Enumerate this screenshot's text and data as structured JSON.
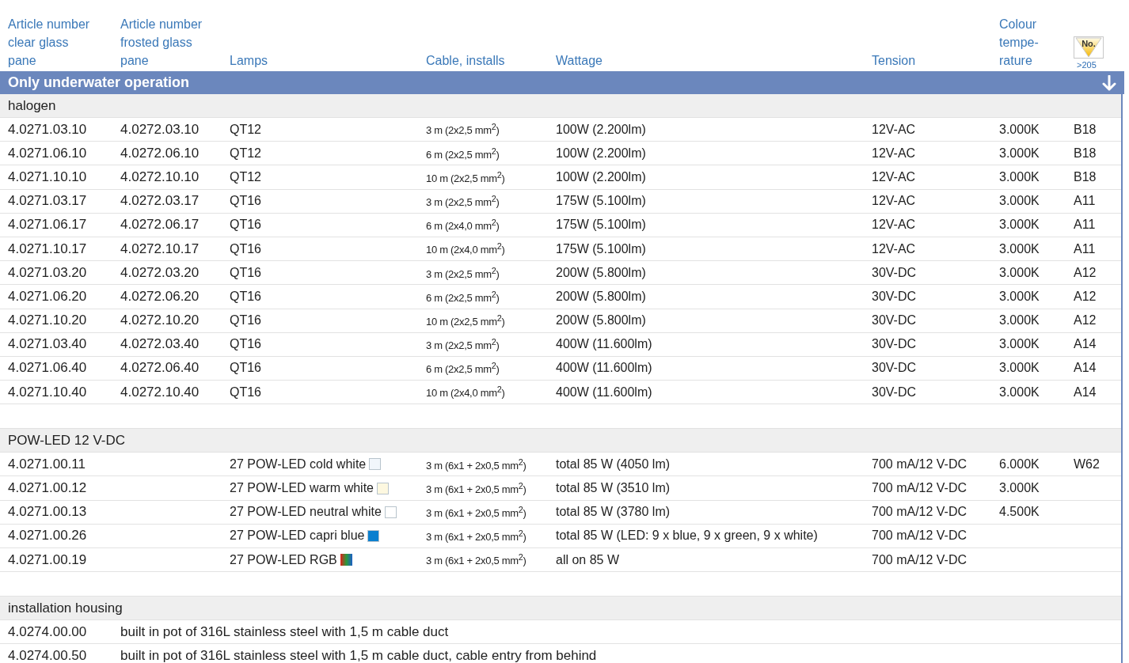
{
  "columns": [
    {
      "lines": [
        "Article number",
        "clear glass",
        "pane"
      ]
    },
    {
      "lines": [
        "Article number",
        "frosted glass",
        "pane"
      ]
    },
    {
      "lines": [
        "Lamps"
      ]
    },
    {
      "lines": [
        "Cable, installs"
      ]
    },
    {
      "lines": [
        "Wattage"
      ]
    },
    {
      "lines": [
        "Tension"
      ]
    },
    {
      "lines": [
        "Colour",
        "tempe-",
        "rature"
      ]
    },
    {
      "kind": "badge",
      "badge_text": "No.",
      "caption": ">205"
    }
  ],
  "banner": {
    "title": "Only underwater operation"
  },
  "sections": [
    {
      "title": "halogen",
      "rows": [
        {
          "kind": "product",
          "clear": "4.0271.03.10",
          "frosted": "4.0272.03.10",
          "lamp": "QT12",
          "cable": "3 m (2x2,5 mm$^{2}$)",
          "wattage": "100W (2.200lm)",
          "tension": "12V-AC",
          "temperature": "3.000K",
          "ref": "B18"
        },
        {
          "kind": "product",
          "clear": "4.0271.06.10",
          "frosted": "4.0272.06.10",
          "lamp": "QT12",
          "cable": "6 m (2x2,5 mm$^{2}$)",
          "wattage": "100W (2.200lm)",
          "tension": "12V-AC",
          "temperature": "3.000K",
          "ref": "B18"
        },
        {
          "kind": "product",
          "clear": "4.0271.10.10",
          "frosted": "4.0272.10.10",
          "lamp": "QT12",
          "cable": "10 m (2x2,5 mm$^{2}$)",
          "wattage": "100W (2.200lm)",
          "tension": "12V-AC",
          "temperature": "3.000K",
          "ref": "B18"
        },
        {
          "kind": "product",
          "clear": "4.0271.03.17",
          "frosted": "4.0272.03.17",
          "lamp": "QT16",
          "cable": "3 m (2x2,5 mm$^{2}$)",
          "wattage": "175W (5.100lm)",
          "tension": "12V-AC",
          "temperature": "3.000K",
          "ref": "A11"
        },
        {
          "kind": "product",
          "clear": "4.0271.06.17",
          "frosted": "4.0272.06.17",
          "lamp": "QT16",
          "cable": "6 m (2x4,0 mm$^{2}$)",
          "wattage": "175W (5.100lm)",
          "tension": "12V-AC",
          "temperature": "3.000K",
          "ref": "A11"
        },
        {
          "kind": "product",
          "clear": "4.0271.10.17",
          "frosted": "4.0272.10.17",
          "lamp": "QT16",
          "cable": "10 m (2x4,0 mm$^{2}$)",
          "wattage": "175W (5.100lm)",
          "tension": "12V-AC",
          "temperature": "3.000K",
          "ref": "A11"
        },
        {
          "kind": "product",
          "clear": "4.0271.03.20",
          "frosted": "4.0272.03.20",
          "lamp": "QT16",
          "cable": "3 m (2x2,5 mm$^{2}$)",
          "wattage": "200W (5.800lm)",
          "tension": "30V-DC",
          "temperature": "3.000K",
          "ref": "A12"
        },
        {
          "kind": "product",
          "clear": "4.0271.06.20",
          "frosted": "4.0272.06.20",
          "lamp": "QT16",
          "cable": "6 m (2x2,5 mm$^{2}$)",
          "wattage": "200W (5.800lm)",
          "tension": "30V-DC",
          "temperature": "3.000K",
          "ref": "A12"
        },
        {
          "kind": "product",
          "clear": "4.0271.10.20",
          "frosted": "4.0272.10.20",
          "lamp": "QT16",
          "cable": "10 m (2x2,5 mm$^{2}$)",
          "wattage": "200W (5.800lm)",
          "tension": "30V-DC",
          "temperature": "3.000K",
          "ref": "A12"
        },
        {
          "kind": "product",
          "clear": "4.0271.03.40",
          "frosted": "4.0272.03.40",
          "lamp": "QT16",
          "cable": "3 m (2x2,5 mm$^{2}$)",
          "wattage": "400W (11.600lm)",
          "tension": "30V-DC",
          "temperature": "3.000K",
          "ref": "A14"
        },
        {
          "kind": "product",
          "clear": "4.0271.06.40",
          "frosted": "4.0272.06.40",
          "lamp": "QT16",
          "cable": "6 m (2x2,5 mm$^{2}$)",
          "wattage": "400W (11.600lm)",
          "tension": "30V-DC",
          "temperature": "3.000K",
          "ref": "A14"
        },
        {
          "kind": "product",
          "clear": "4.0271.10.40",
          "frosted": "4.0272.10.40",
          "lamp": "QT16",
          "cable": "10 m (2x4,0 mm$^{2}$)",
          "wattage": "400W (11.600lm)",
          "tension": "30V-DC",
          "temperature": "3.000K",
          "ref": "A14"
        }
      ]
    },
    {
      "title": "POW-LED 12 V-DC",
      "rows": [
        {
          "kind": "product",
          "clear": "4.0271.00.11",
          "lamp": "27 POW-LED cold white",
          "swatch": {
            "kind": "solid",
            "color": "#f1f6fb"
          },
          "cable": "3 m (6x1 + 2x0,5 mm$^{2}$)",
          "wattage": "total 85 W (4050 lm)",
          "tension": "700 mA/12 V-DC",
          "temperature": "6.000K",
          "ref": "W62"
        },
        {
          "kind": "product",
          "clear": "4.0271.00.12",
          "lamp": "27 POW-LED warm white",
          "swatch": {
            "kind": "solid",
            "color": "#fdf8e0"
          },
          "cable": "3 m (6x1 + 2x0,5 mm$^{2}$)",
          "wattage": "total 85 W (3510 lm)",
          "tension": "700 mA/12 V-DC",
          "temperature": "3.000K"
        },
        {
          "kind": "product",
          "clear": "4.0271.00.13",
          "lamp": "27 POW-LED neutral white",
          "swatch": {
            "kind": "solid",
            "color": "#ffffff"
          },
          "cable": "3 m (6x1 + 2x0,5 mm$^{2}$)",
          "wattage": "total 85 W (3780 lm)",
          "tension": "700 mA/12 V-DC",
          "temperature": "4.500K"
        },
        {
          "kind": "product",
          "clear": "4.0271.00.26",
          "lamp": "27 POW-LED capri blue",
          "swatch": {
            "kind": "solid",
            "color": "#0a7fcf"
          },
          "cable": "3 m (6x1 + 2x0,5 mm$^{2}$)",
          "wattage": "total 85 W (LED: 9 x blue, 9 x green, 9 x white)",
          "tension": "700 mA/12 V-DC"
        },
        {
          "kind": "product",
          "clear": "4.0271.00.19",
          "lamp": "27 POW-LED RGB",
          "swatch": {
            "kind": "rgb"
          },
          "cable": "3 m (6x1 + 2x0,5 mm$^{2}$)",
          "wattage": "all on 85 W",
          "tension": "700 mA/12 V-DC"
        }
      ]
    },
    {
      "title": "installation housing",
      "rows": [
        {
          "kind": "note",
          "clear": "4.0274.00.00",
          "description": "built in pot of 316L stainless steel with 1,5 m cable duct"
        },
        {
          "kind": "note",
          "clear": "4.0274.00.50",
          "description": "built in pot of 316L stainless steel with 1,5 m cable duct, cable entry from behind"
        }
      ]
    }
  ]
}
